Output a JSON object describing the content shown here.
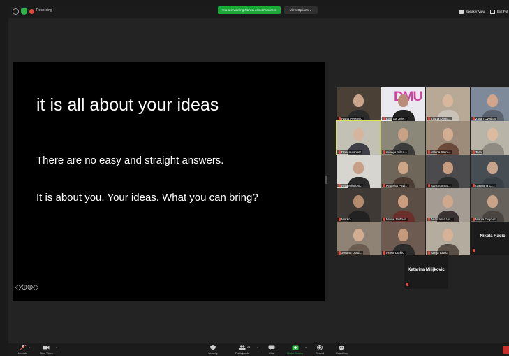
{
  "topbar": {
    "recording_label": "Recording",
    "viewing_banner": "You are viewing Ranen Jonker's screen",
    "view_options": "View Options ⌄",
    "speaker_view": "Speaker View",
    "exit_full": "Exit Full"
  },
  "slide": {
    "title": "it is all about your ideas",
    "line1": "There are no easy and straight answers.",
    "line2": "It is about you. Your ideas. What you can bring?",
    "annotation_tools": "◇∕⊕⊕◇"
  },
  "participants": [
    {
      "name": "Ivana Perkovic",
      "bg": "#4a4036",
      "skin": "#c9a48a",
      "shirt": "#2b2b2b"
    },
    {
      "name": "Darinka Jele...",
      "bg": "#e9e9ef",
      "skin": "#b98e78",
      "shirt": "#222222",
      "logo": "DMU"
    },
    {
      "name": "Tijana Dimitr...",
      "bg": "#b7a995",
      "skin": "#d8b89c",
      "shirt": "#c8c2b8"
    },
    {
      "name": "Zoran Cvetkov",
      "bg": "#7e8a99",
      "skin": "#d2a58b",
      "shirt": "#5b6370"
    },
    {
      "name": "Ranen Jonker",
      "bg": "#c2c1b3",
      "skin": "#d6b59f",
      "shirt": "#3e3f47",
      "active": true
    },
    {
      "name": "mihajlo milen...",
      "bg": "#8c8879",
      "skin": "#c9a184",
      "shirt": "#3b3b3b"
    },
    {
      "name": "Milena Stani...",
      "bg": "#9d8c7a",
      "skin": "#d4ae93",
      "shirt": "#6a4a3a"
    },
    {
      "name": "Tara",
      "bg": "#b9b4a8",
      "skin": "#dcbba1",
      "shirt": "#8f8a82"
    },
    {
      "name": "Anja Mijailovic",
      "bg": "#d7d5cf",
      "skin": "#c7a087",
      "shirt": "#2a2a2a"
    },
    {
      "name": "Natasha Pavl...",
      "bg": "#6e6658",
      "skin": "#cda688",
      "shirt": "#4a3c33"
    },
    {
      "name": "Sara Stamat...",
      "bg": "#4b4a4c",
      "skin": "#c79d80",
      "shirt": "#2c2c2c"
    },
    {
      "name": "Gavriana Cr...",
      "bg": "#474e53",
      "skin": "#c9a48c",
      "shirt": "#3a4146"
    },
    {
      "name": "Marko",
      "bg": "#3e3934",
      "skin": "#b48a6d",
      "shirt": "#222222"
    },
    {
      "name": "Milica Jevtovic",
      "bg": "#5a4e45",
      "skin": "#c99d7d",
      "shirt": "#6a2f2a"
    },
    {
      "name": "Anastasija Vu...",
      "bg": "#a59d93",
      "skin": "#cfa88d",
      "shirt": "#3b3333"
    },
    {
      "name": "Marija Cvijovic",
      "bg": "#66625b",
      "skin": "#c9a388",
      "shirt": "#4a4540"
    },
    {
      "name": "Jovana Dord...",
      "bg": "#8f8375",
      "skin": "#d2ad92",
      "shirt": "#6b5d52"
    },
    {
      "name": "Anela Durkic",
      "bg": "#6d5b52",
      "skin": "#c59a7c",
      "shirt": "#2b2b2b"
    },
    {
      "name": "Sonja Ristic",
      "bg": "#b3ac9f",
      "skin": "#d6b296",
      "shirt": "#5a4f46"
    },
    {
      "name": "Nikola Radic",
      "type": "name"
    },
    {
      "name": "Katarina Milijkovic",
      "type": "name"
    }
  ],
  "toolbar": {
    "unmute": "Unmute",
    "start_video": "Start Video",
    "security": "Security",
    "participants": "Participants",
    "participants_count": "21",
    "chat": "Chat",
    "share_screen": "Share Screen",
    "record": "Record",
    "reactions": "Reactions"
  },
  "colors": {
    "share_green": "#1fa83a",
    "record_red": "#e0463d",
    "active_speaker": "#d7e44b"
  }
}
